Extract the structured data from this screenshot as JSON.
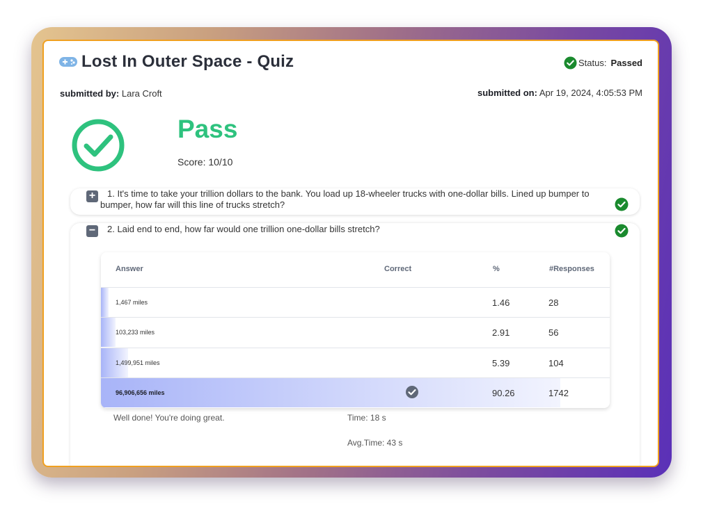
{
  "quiz": {
    "title": "Lost In Outer Space - Quiz",
    "status_label": "Status:",
    "status_value": "Passed",
    "submitted_by_label": "submitted by:",
    "submitted_by": "Lara Croft",
    "submitted_on_label": "submitted on:",
    "submitted_on": "Apr 19, 2024, 4:05:53 PM",
    "result": "Pass",
    "score": "Score: 10/10"
  },
  "questions": [
    {
      "toggle": "+",
      "text": "1. It's time to take your trillion dollars to the bank. You load up 18-wheeler trucks with one-dollar bills. Lined up bumper to bumper, how far will this line of trucks stretch?"
    },
    {
      "toggle": "−",
      "text": "2. Laid end to end, how far would one trillion one-dollar bills stretch?"
    }
  ],
  "answer_table": {
    "headers": {
      "answer": "Answer",
      "correct": "Correct",
      "percent": "%",
      "responses": "#Responses"
    },
    "rows": [
      {
        "answer": "1,467 miles",
        "percent": "1.46",
        "responses": "28",
        "percent_value": 1.46,
        "correct": false
      },
      {
        "answer": "103,233 miles",
        "percent": "2.91",
        "responses": "56",
        "percent_value": 2.91,
        "correct": false
      },
      {
        "answer": "1,499,951 miles",
        "percent": "5.39",
        "responses": "104",
        "percent_value": 5.39,
        "correct": false
      },
      {
        "answer": "96,906,656 miles",
        "percent": "90.26",
        "responses": "1742",
        "percent_value": 90.26,
        "correct": true
      }
    ]
  },
  "feedback": {
    "message": "Well done! You're doing great.",
    "time": "Time: 18 s",
    "avg_time": "Avg.Time: 43 s"
  },
  "colors": {
    "pass_green": "#2ec27e",
    "check_green": "#1a8a2e",
    "accent_border": "#f0a020",
    "bar_blue": "#a8b4f8"
  },
  "icons": {
    "title": "gamepad-icon",
    "status": "check-circle-icon",
    "result": "big-check-icon",
    "correct": "check-circle-gray-icon"
  }
}
